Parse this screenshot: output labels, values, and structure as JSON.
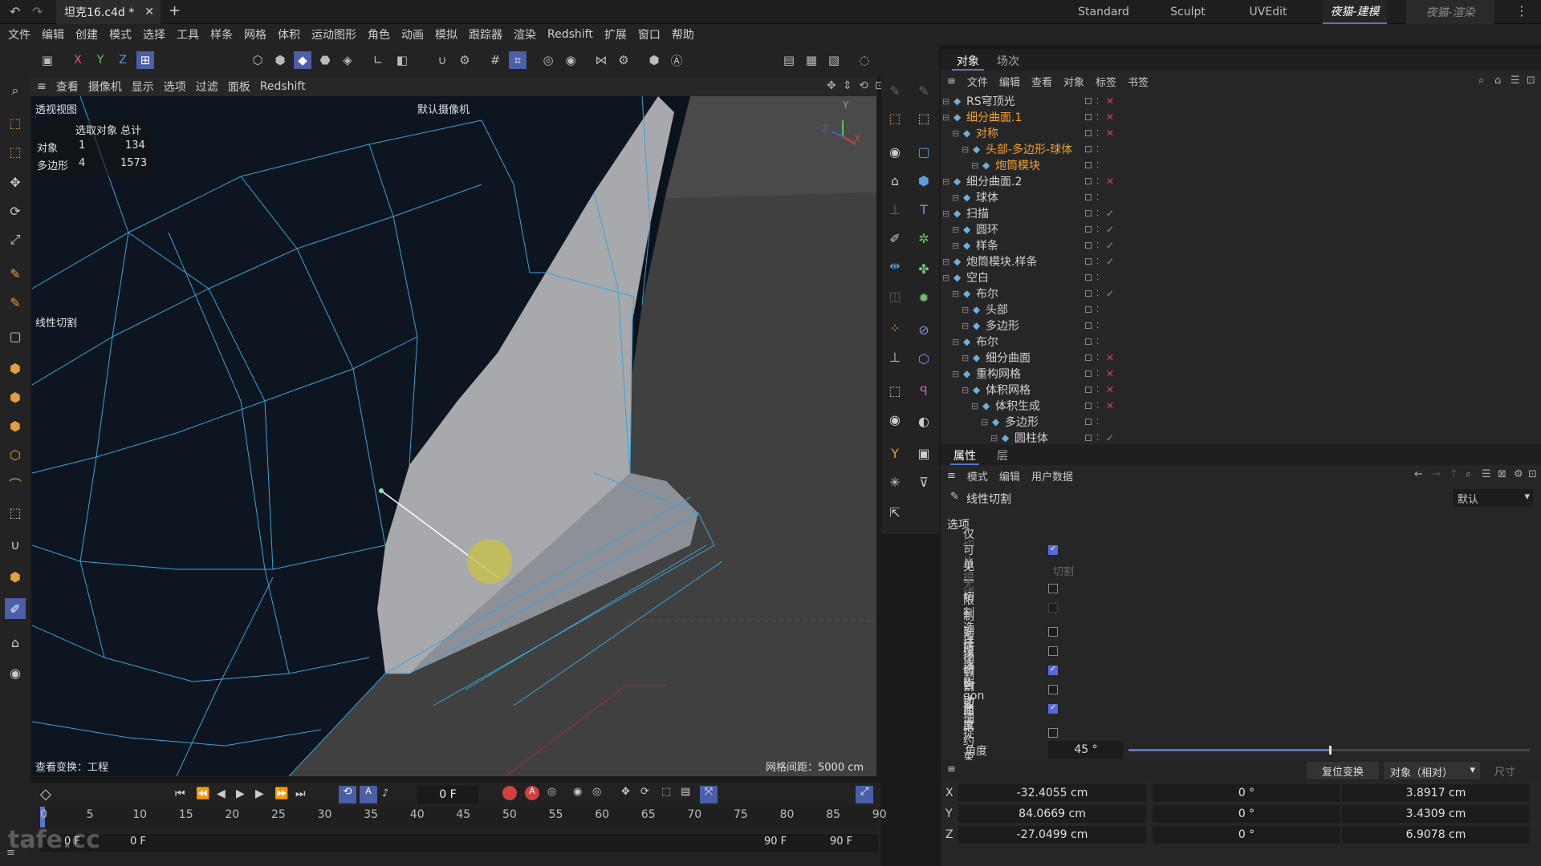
{
  "topbar": {
    "document_tab": "坦克16.c4d *",
    "layouts": [
      "Standard",
      "Sculpt",
      "UVEdit",
      "夜猫-建模",
      "夜猫-渲染"
    ],
    "active_layout": "夜猫-建模"
  },
  "menu": [
    "文件",
    "编辑",
    "创建",
    "模式",
    "选择",
    "工具",
    "样条",
    "网格",
    "体积",
    "运动图形",
    "角色",
    "动画",
    "模拟",
    "跟踪器",
    "渲染",
    "Redshift",
    "扩展",
    "窗口",
    "帮助"
  ],
  "axis_lock": [
    "X",
    "Y",
    "Z"
  ],
  "viewport": {
    "menu": [
      "查看",
      "摄像机",
      "显示",
      "选项",
      "过滤",
      "面板",
      "Redshift"
    ],
    "title": "透视视图",
    "camera": "默认摄像机",
    "hud": {
      "header": "选取对象 总计",
      "rows": [
        {
          "label": "对象",
          "selected": "1",
          "total": "134"
        },
        {
          "label": "多边形",
          "selected": "4",
          "total": "1573"
        }
      ]
    },
    "tool_label": "线性切割",
    "footer_left": "查看变换：工程",
    "footer_right": "网格间距：5000 cm",
    "axis_labels": {
      "y": "Y",
      "z": "Z",
      "x": "X"
    }
  },
  "object_manager": {
    "tabs": [
      "对象",
      "场次"
    ],
    "menu": [
      "文件",
      "编辑",
      "查看",
      "对象",
      "标签",
      "书签"
    ],
    "rows": [
      {
        "name": "RS穹顶光",
        "indent": 0,
        "selected": false,
        "status": "x"
      },
      {
        "name": "细分曲面.1",
        "indent": 0,
        "selected": true,
        "status": "x"
      },
      {
        "name": "对称",
        "indent": 1,
        "selected": true,
        "status": "x"
      },
      {
        "name": "头部-多边形-球体",
        "indent": 2,
        "selected": true,
        "status": ""
      },
      {
        "name": "炮筒模块",
        "indent": 3,
        "selected": true,
        "status": ""
      },
      {
        "name": "细分曲面.2",
        "indent": 0,
        "selected": false,
        "status": "x"
      },
      {
        "name": "球体",
        "indent": 1,
        "selected": false,
        "status": ""
      },
      {
        "name": "扫描",
        "indent": 0,
        "selected": false,
        "status": "check"
      },
      {
        "name": "圆环",
        "indent": 1,
        "selected": false,
        "status": "check"
      },
      {
        "name": "样条",
        "indent": 1,
        "selected": false,
        "status": "check"
      },
      {
        "name": "炮筒模块.样条",
        "indent": 0,
        "selected": false,
        "status": "check"
      },
      {
        "name": "空白",
        "indent": 0,
        "selected": false,
        "status": ""
      },
      {
        "name": "布尔",
        "indent": 1,
        "selected": false,
        "status": "check"
      },
      {
        "name": "头部",
        "indent": 2,
        "selected": false,
        "status": ""
      },
      {
        "name": "多边形",
        "indent": 2,
        "selected": false,
        "status": ""
      },
      {
        "name": "布尔",
        "indent": 1,
        "selected": false,
        "status": ""
      },
      {
        "name": "细分曲面",
        "indent": 2,
        "selected": false,
        "status": "x"
      },
      {
        "name": "重构网格",
        "indent": 1,
        "selected": false,
        "status": "x"
      },
      {
        "name": "体积网格",
        "indent": 2,
        "selected": false,
        "status": "x"
      },
      {
        "name": "体积生成",
        "indent": 3,
        "selected": false,
        "status": "x"
      },
      {
        "name": "多边形",
        "indent": 4,
        "selected": false,
        "status": ""
      },
      {
        "name": "圆柱体",
        "indent": 5,
        "selected": false,
        "status": "check"
      }
    ]
  },
  "attributes": {
    "tabs": [
      "属性",
      "层"
    ],
    "menu": [
      "模式",
      "编辑",
      "用户数据"
    ],
    "tool_name": "线性切割",
    "preset": "默认",
    "section": "选项",
    "options": [
      {
        "label": "仅可见",
        "checked": true,
        "disabled": false
      },
      {
        "label": "切片模式",
        "checked": false,
        "disabled": true,
        "value": "切割"
      },
      {
        "label": "单一切割",
        "checked": false,
        "disabled": false
      },
      {
        "label": "无限切割",
        "checked": false,
        "disabled": true
      },
      {
        "label": "限制到所选",
        "checked": false,
        "disabled": false
      },
      {
        "label": "选择切割",
        "checked": false,
        "disabled": false
      },
      {
        "label": "连接切割边",
        "checked": true,
        "disabled": false
      },
      {
        "label": "保持N-gon曲率",
        "checked": false,
        "disabled": false
      },
      {
        "label": "自动捕捉",
        "checked": true,
        "disabled": false
      },
      {
        "label": "角度约束",
        "checked": false,
        "disabled": false
      }
    ],
    "angle_label": "角度",
    "angle_value": "45 °",
    "angle_fraction": 0.5
  },
  "coordinates": {
    "reset_button": "复位变换",
    "mode": "对象（相对）",
    "size_label": "尺寸",
    "rows": [
      {
        "axis": "X",
        "pos": "-32.4055 cm",
        "rot": "0 °",
        "size": "3.8917 cm"
      },
      {
        "axis": "Y",
        "pos": "84.0669 cm",
        "rot": "0 °",
        "size": "3.4309 cm"
      },
      {
        "axis": "Z",
        "pos": "-27.0499 cm",
        "rot": "0 °",
        "size": "6.9078 cm"
      }
    ]
  },
  "timeline": {
    "current_frame": "0 F",
    "ticks": [
      "0",
      "5",
      "10",
      "15",
      "20",
      "25",
      "30",
      "35",
      "40",
      "45",
      "50",
      "55",
      "60",
      "65",
      "70",
      "75",
      "80",
      "85",
      "90"
    ],
    "start": "0 F",
    "start2": "0 F",
    "end": "90 F",
    "end2": "90 F"
  },
  "watermark": "tafe.cc"
}
